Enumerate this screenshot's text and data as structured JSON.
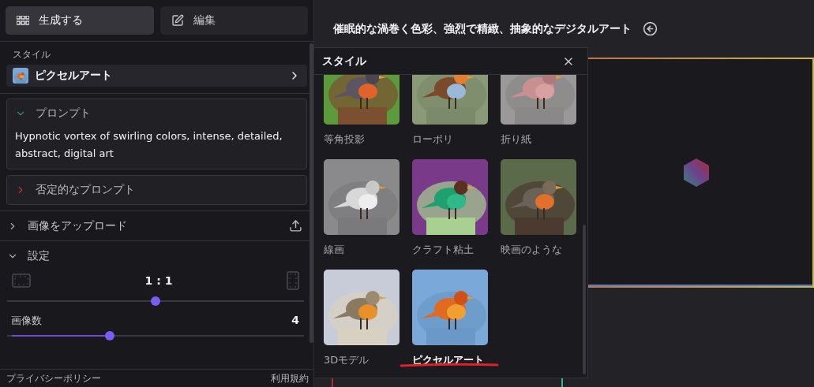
{
  "tabs": [
    {
      "kind": "generate",
      "label": "生成する",
      "selected": true
    },
    {
      "kind": "edit",
      "label": "編集",
      "selected": false
    }
  ],
  "style_field": {
    "label": "スタイル",
    "value": "ピクセルアート"
  },
  "prompt": {
    "title": "プロンプト",
    "expanded": true,
    "text": "Hypnotic vortex of swirling colors, intense, detailed, abstract, digital art"
  },
  "negative_prompt": {
    "title": "否定的なプロンプト",
    "expanded": false
  },
  "upload": {
    "title": "画像をアップロード",
    "expanded": false
  },
  "settings": {
    "title": "設定",
    "expanded": true,
    "aspect_ratio": {
      "reading": "1 : 1",
      "level": 0.5
    },
    "image_count": {
      "label": "画像数",
      "reading": "4",
      "level": 0.34
    }
  },
  "footer": {
    "privacy": "プライバシーポリシー",
    "terms": "利用規約"
  },
  "main": {
    "title": "催眠的な渦巻く色彩、強烈で精緻、抽象的なデジタルアート"
  },
  "style_dialog": {
    "title": "スタイル",
    "styles": [
      {
        "label": "等角投影",
        "selected": false
      },
      {
        "label": "ローポリ",
        "selected": false
      },
      {
        "label": "折り紙",
        "selected": false
      },
      {
        "label": "線画",
        "selected": false
      },
      {
        "label": "クラフト粘土",
        "selected": false
      },
      {
        "label": "映画のような",
        "selected": false
      },
      {
        "label": "3Dモデル",
        "selected": false
      },
      {
        "label": "ピクセルアート",
        "selected": true
      }
    ]
  }
}
